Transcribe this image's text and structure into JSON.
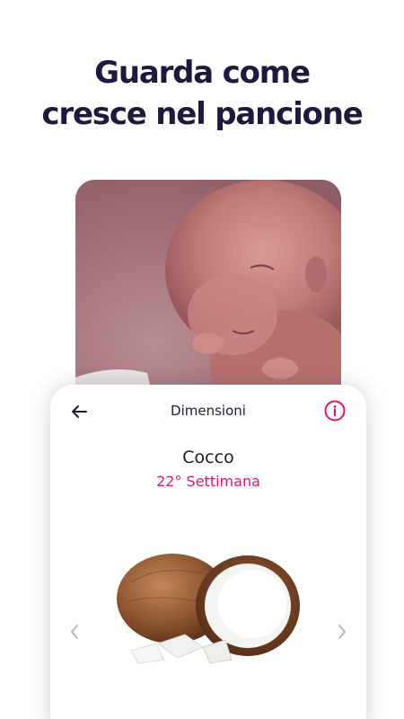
{
  "headline": {
    "line1": "Guarda come",
    "line2": "cresce nel pancione"
  },
  "screen": {
    "title": "Dimensioni",
    "fruit_name": "Cocco",
    "week": "22° Settimana"
  },
  "icons": {
    "back": "arrow-left-icon",
    "info": "info-circle-icon",
    "prev": "chevron-left-icon",
    "next": "chevron-right-icon"
  },
  "colors": {
    "headline": "#1c1a3d",
    "accent": "#e0166c",
    "chevron": "#b5b3bd"
  }
}
